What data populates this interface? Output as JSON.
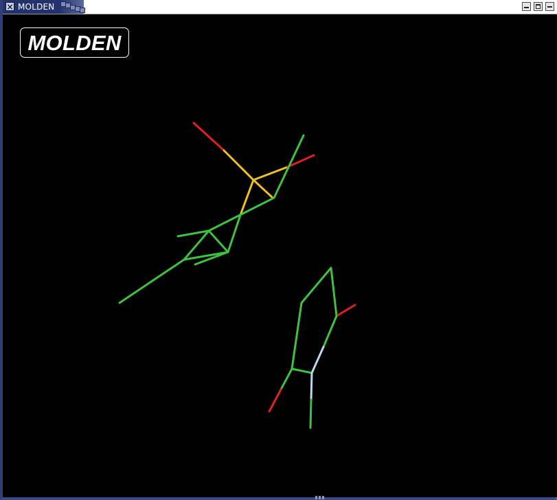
{
  "window": {
    "title": "MOLDEN",
    "controls": [
      "minimize-icon",
      "maximize-icon",
      "close-icon"
    ]
  },
  "viewer": {
    "logo_text": "MOLDEN",
    "background_color": "#000000",
    "bond_colors": {
      "carbon": "#3fc23f",
      "oxygen": "#e02020",
      "sulfur": "#f0c020",
      "nitrogen": "#bcd8ec"
    },
    "molecule_count": 2
  }
}
